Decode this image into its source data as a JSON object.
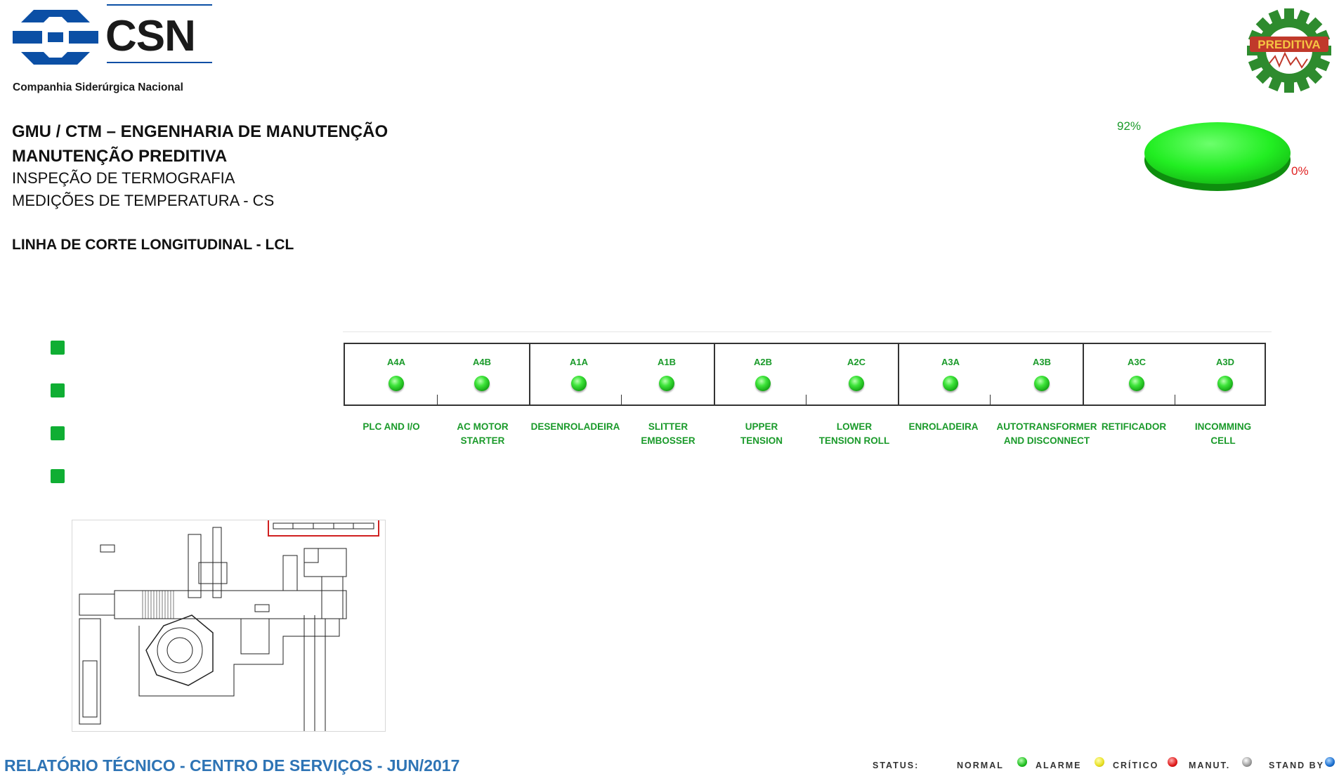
{
  "header": {
    "logo_brand": "CSN",
    "logo_subtitle": "Companhia Siderúrgica Nacional",
    "line1": "GMU / CTM – ENGENHARIA DE MANUTENÇÃO",
    "line2": "MANUTENÇÃO PREDITIVA",
    "line3": "INSPEÇÃO DE TERMOGRAFIA",
    "line4": "MEDIÇÕES DE TEMPERATURA - CS",
    "line5": "LINHA DE CORTE LONGITUDINAL - LCL",
    "badge_text": "PREDITIVA"
  },
  "chart_data": {
    "type": "pie",
    "slices": [
      {
        "label": "92%",
        "value": 92,
        "color": "#22ee22"
      },
      {
        "label": "0%",
        "value": 0,
        "color": "#e02020"
      }
    ]
  },
  "panels": [
    {
      "code": "A4A",
      "desc1": "PLC AND I/O",
      "desc2": ""
    },
    {
      "code": "A4B",
      "desc1": "AC MOTOR",
      "desc2": "STARTER"
    },
    {
      "code": "A1A",
      "desc1": "DESENROLADEIRA",
      "desc2": ""
    },
    {
      "code": "A1B",
      "desc1": "SLITTER",
      "desc2": "EMBOSSER"
    },
    {
      "code": "A2B",
      "desc1": "UPPER",
      "desc2": "TENSION"
    },
    {
      "code": "A2C",
      "desc1": "LOWER",
      "desc2": "TENSION  ROLL"
    },
    {
      "code": "A3A",
      "desc1": "ENROLADEIRA",
      "desc2": ""
    },
    {
      "code": "A3B",
      "desc1": "AUTOTRANSFORMER",
      "desc2": "AND DISCONNECT"
    },
    {
      "code": "A3C",
      "desc1": "RETIFICADOR",
      "desc2": ""
    },
    {
      "code": "A3D",
      "desc1": "INCOMMING",
      "desc2": "CELL"
    }
  ],
  "footer": {
    "title": "RELATÓRIO TÉCNICO - CENTRO DE SERVIÇOS - JUN/2017",
    "legend_status": "STATUS:",
    "legend_normal": "NORMAL",
    "legend_alarme": "ALARME",
    "legend_critico": "CRÍTICO",
    "legend_manut": "MANUT.",
    "legend_standby": "STAND BY",
    "colors": {
      "normal": "#1fbf1f",
      "alarme": "#e8e020",
      "critico": "#e01818",
      "manut": "#9a9a9a",
      "standby": "#1a6fd0"
    }
  }
}
